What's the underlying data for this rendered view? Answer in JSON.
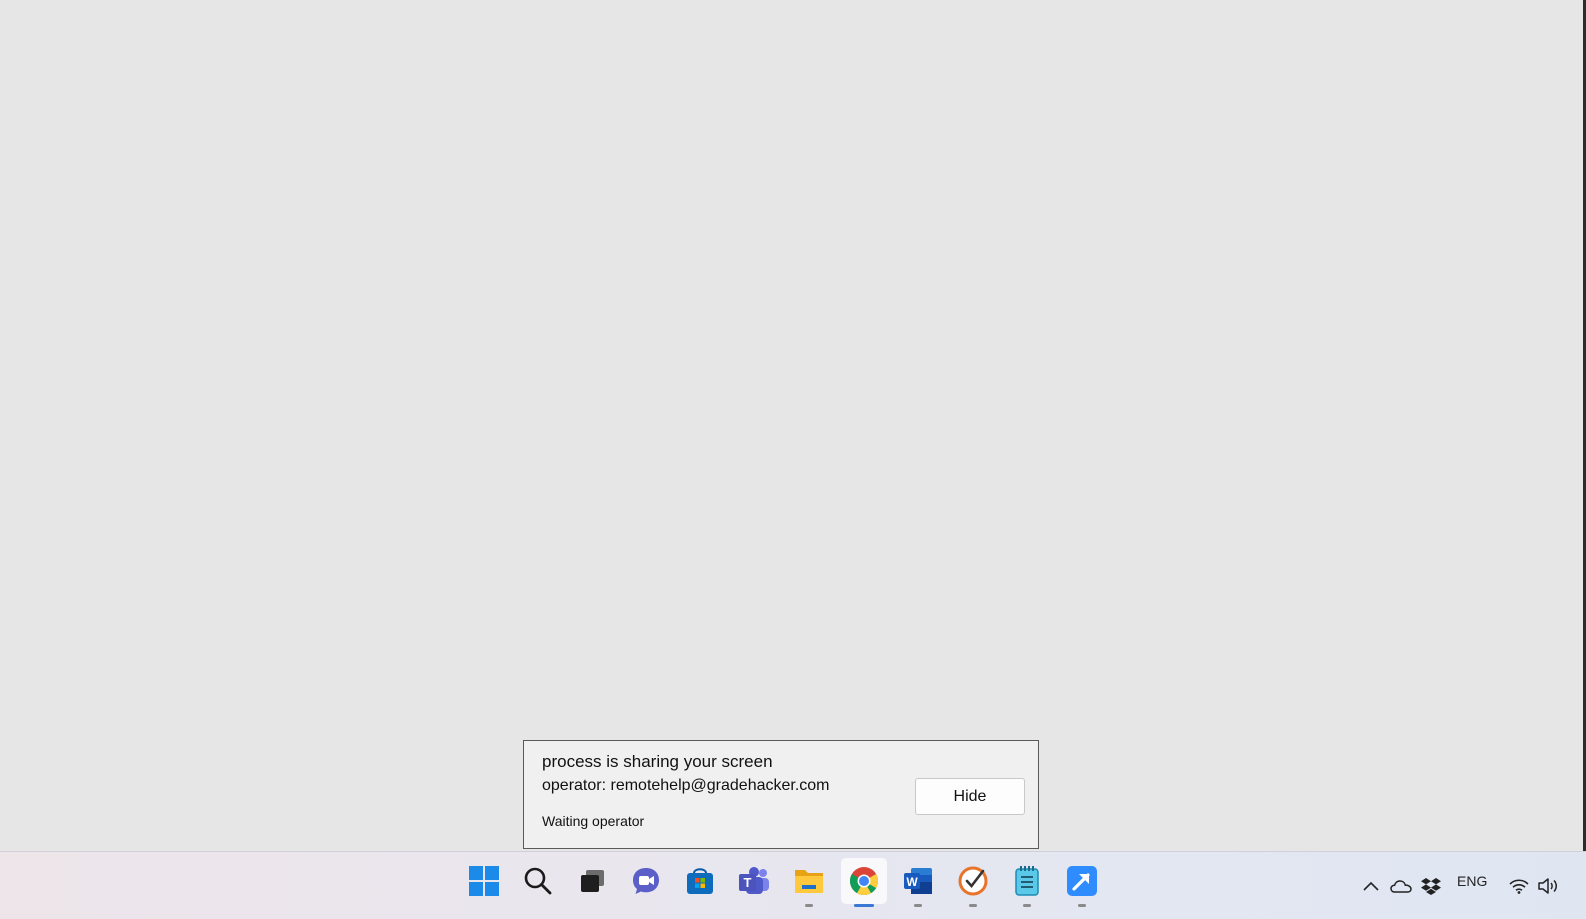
{
  "share_popup": {
    "title": "process is sharing your screen",
    "operator": "operator: remotehelp@gradehacker.com",
    "status": "Waiting operator",
    "hide_label": "Hide"
  },
  "taskbar": {
    "apps": [
      {
        "name": "start-icon",
        "active": false,
        "running": false
      },
      {
        "name": "search-icon",
        "active": false,
        "running": false
      },
      {
        "name": "task-view-icon",
        "active": false,
        "running": false
      },
      {
        "name": "chat-icon",
        "active": false,
        "running": false
      },
      {
        "name": "microsoft-store-icon",
        "active": false,
        "running": false
      },
      {
        "name": "teams-icon",
        "active": false,
        "running": false
      },
      {
        "name": "file-explorer-icon",
        "active": false,
        "running": true
      },
      {
        "name": "chrome-icon",
        "active": true,
        "running": true
      },
      {
        "name": "word-icon",
        "active": false,
        "running": true
      },
      {
        "name": "todo-icon",
        "active": false,
        "running": true
      },
      {
        "name": "notepad-icon",
        "active": false,
        "running": true
      },
      {
        "name": "remote-help-icon",
        "active": false,
        "running": true
      }
    ],
    "tray": {
      "language": "ENG",
      "icons": [
        "chevron-up-icon",
        "onedrive-icon",
        "dropbox-icon",
        "wifi-icon",
        "volume-icon"
      ]
    }
  },
  "colors": {
    "desktop": "#e6e6e6",
    "popup_bg": "#f0f0f0",
    "accent": "#3a78d4"
  }
}
